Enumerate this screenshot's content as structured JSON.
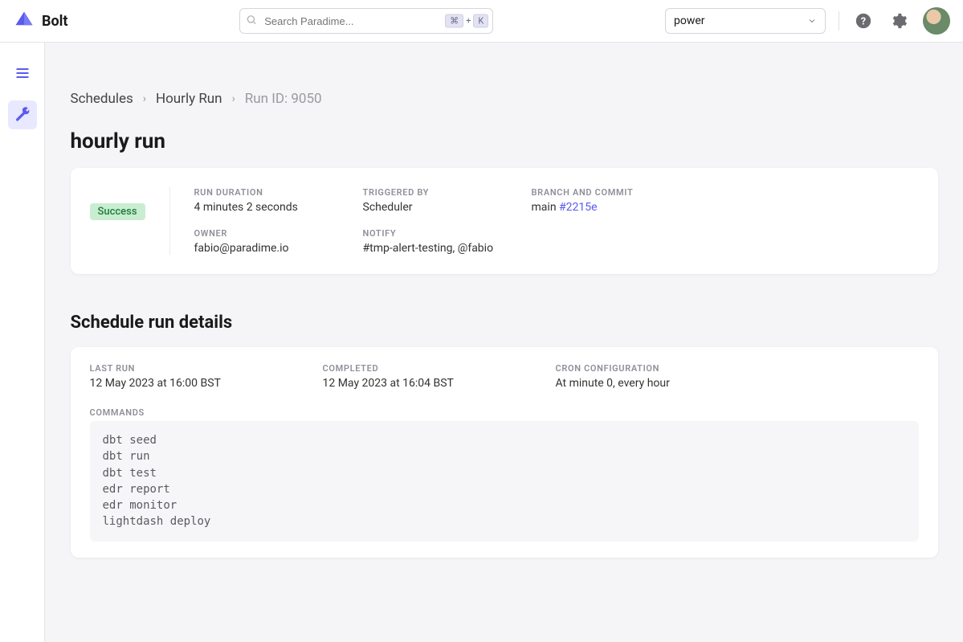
{
  "brand": {
    "name": "Bolt"
  },
  "search": {
    "placeholder": "Search Paradime...",
    "kbd1": "⌘",
    "kbdPlus": "+",
    "kbd2": "K"
  },
  "workspace": {
    "selected": "power"
  },
  "breadcrumb": {
    "schedules": "Schedules",
    "run_name": "Hourly Run",
    "run_id": "Run ID: 9050"
  },
  "page": {
    "title": "hourly run"
  },
  "status": {
    "label": "Success"
  },
  "summary": {
    "run_duration": {
      "label": "RUN DURATION",
      "value": "4 minutes 2 seconds"
    },
    "triggered_by": {
      "label": "TRIGGERED BY",
      "value": "Scheduler"
    },
    "branch_commit": {
      "label": "BRANCH AND COMMIT",
      "branch": "main ",
      "commit": "#2215e"
    },
    "owner": {
      "label": "OWNER",
      "value": "fabio@paradime.io"
    },
    "notify": {
      "label": "NOTIFY",
      "value": "#tmp-alert-testing, @fabio"
    }
  },
  "details": {
    "section_title": "Schedule run details",
    "last_run": {
      "label": "LAST RUN",
      "value": "12 May 2023 at 16:00 BST"
    },
    "completed": {
      "label": "COMPLETED",
      "value": "12 May 2023 at 16:04 BST"
    },
    "cron": {
      "label": "CRON CONFIGURATION",
      "value": "At minute 0, every hour"
    },
    "commands": {
      "label": "COMMANDS",
      "value": "dbt seed\ndbt run\ndbt test\nedr report\nedr monitor\nlightdash deploy"
    }
  }
}
